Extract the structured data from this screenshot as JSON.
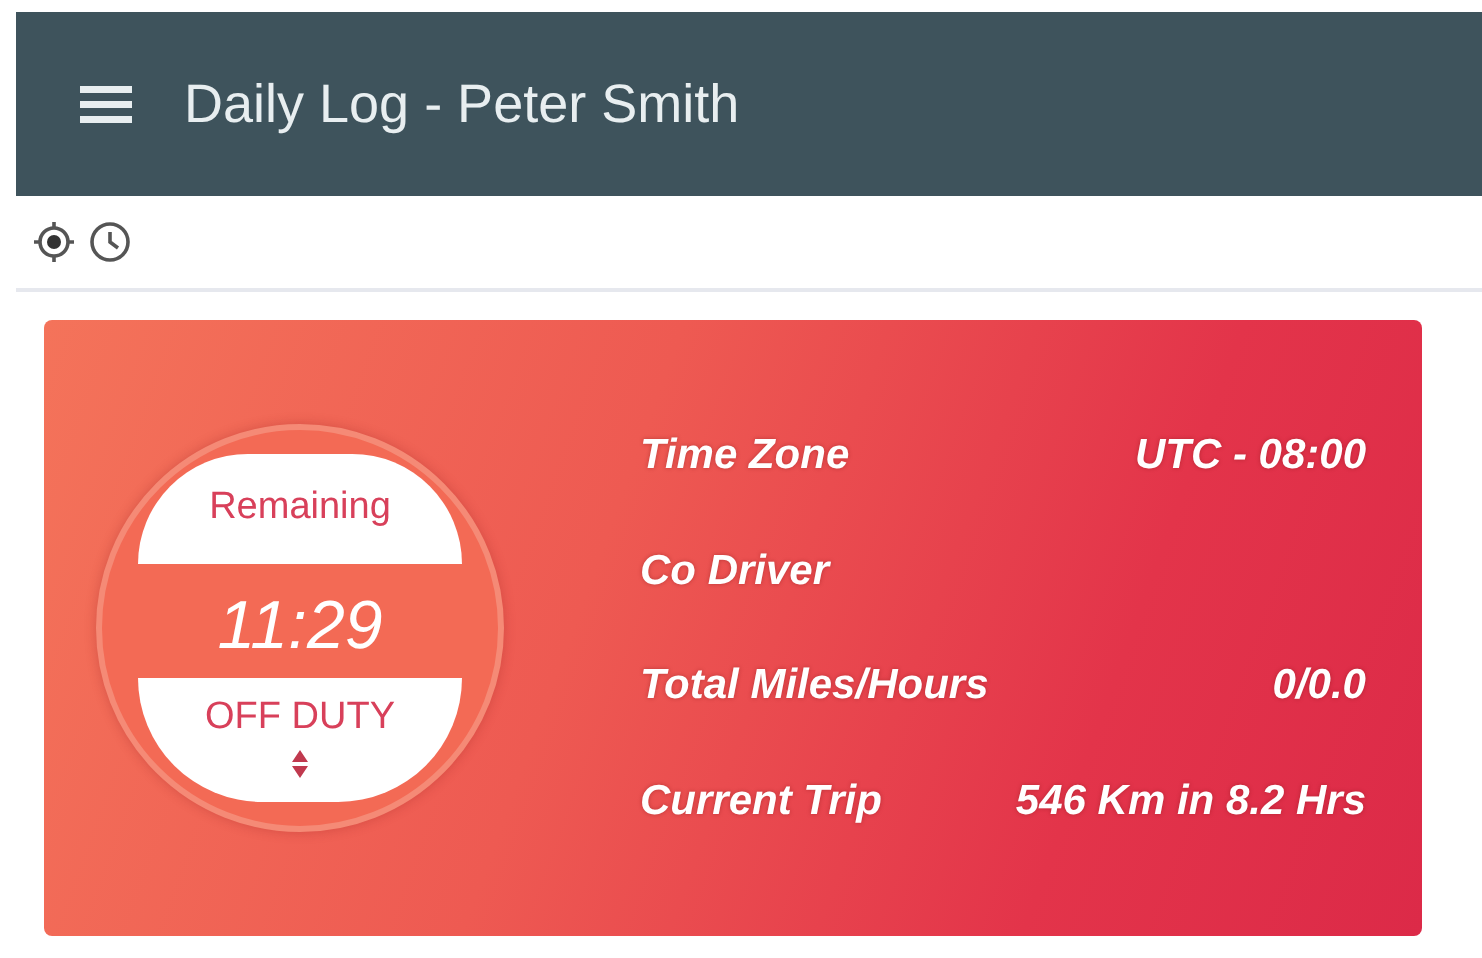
{
  "app_bar": {
    "title": "Daily Log - Peter Smith"
  },
  "dial": {
    "label": "Remaining",
    "time": "11:29",
    "status": "OFF DUTY"
  },
  "info": [
    {
      "label": "Time Zone",
      "value": "UTC - 08:00"
    },
    {
      "label": "Co Driver"
    },
    {
      "label": "Total Miles/Hours",
      "value": "0/0.0"
    },
    {
      "label": "Current Trip",
      "value": "546 Km in 8.2 Hrs"
    }
  ]
}
